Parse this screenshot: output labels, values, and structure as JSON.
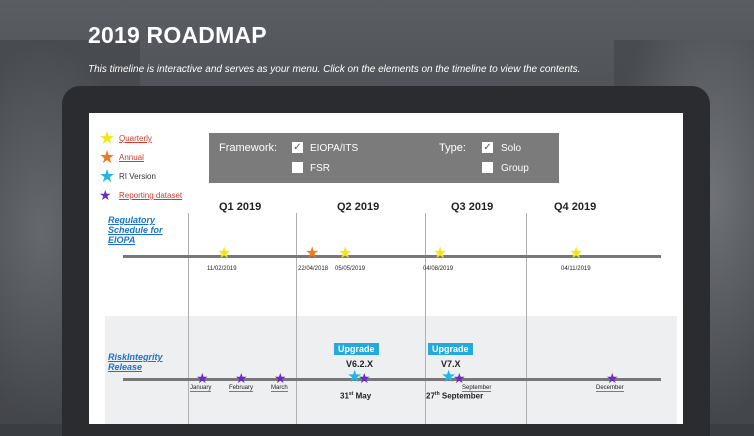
{
  "header": {
    "title": "2019 ROADMAP",
    "subtitle": "This timeline is interactive and serves as your menu. Click on the elements on the timeline to view the contents."
  },
  "legend": [
    {
      "label": "Quarterly",
      "color": "#f7e51b",
      "icon": "star-icon"
    },
    {
      "label": "Annual",
      "color": "#f07a22",
      "icon": "star-icon"
    },
    {
      "label": "RI Version",
      "color": "#21b6e8",
      "icon": "star-icon"
    },
    {
      "label": "Reporting dataset",
      "color": "#6a2bc4",
      "icon": "star-icon"
    }
  ],
  "filters": {
    "framework_label": "Framework:",
    "framework_options": [
      {
        "label": "EIOPA/ITS",
        "checked": true
      },
      {
        "label": "FSR",
        "checked": false
      }
    ],
    "type_label": "Type:",
    "type_options": [
      {
        "label": "Solo",
        "checked": true
      },
      {
        "label": "Group",
        "checked": false
      }
    ]
  },
  "quarters": [
    "Q1 2019",
    "Q2 2019",
    "Q3 2019",
    "Q4 2019"
  ],
  "regulatory": {
    "label_line1": "Regulatory",
    "label_line2": "Schedule for",
    "label_line3": "EIOPA",
    "dates": [
      "11/02/2019",
      "22/04/2018",
      "05/05/2019",
      "04/08/2019",
      "04/11/2019"
    ]
  },
  "release": {
    "label_line1": "RiskIntegrity",
    "label_line2": "Release",
    "upgrades": [
      {
        "label": "Upgrade",
        "version": "V6.2.X",
        "day": "31",
        "suffix": "st",
        "month": "May"
      },
      {
        "label": "Upgrade",
        "version": "V7.X",
        "day": "27",
        "suffix": "th",
        "month": "September"
      }
    ],
    "months": [
      "January",
      "February",
      "March",
      "September",
      "December"
    ]
  }
}
